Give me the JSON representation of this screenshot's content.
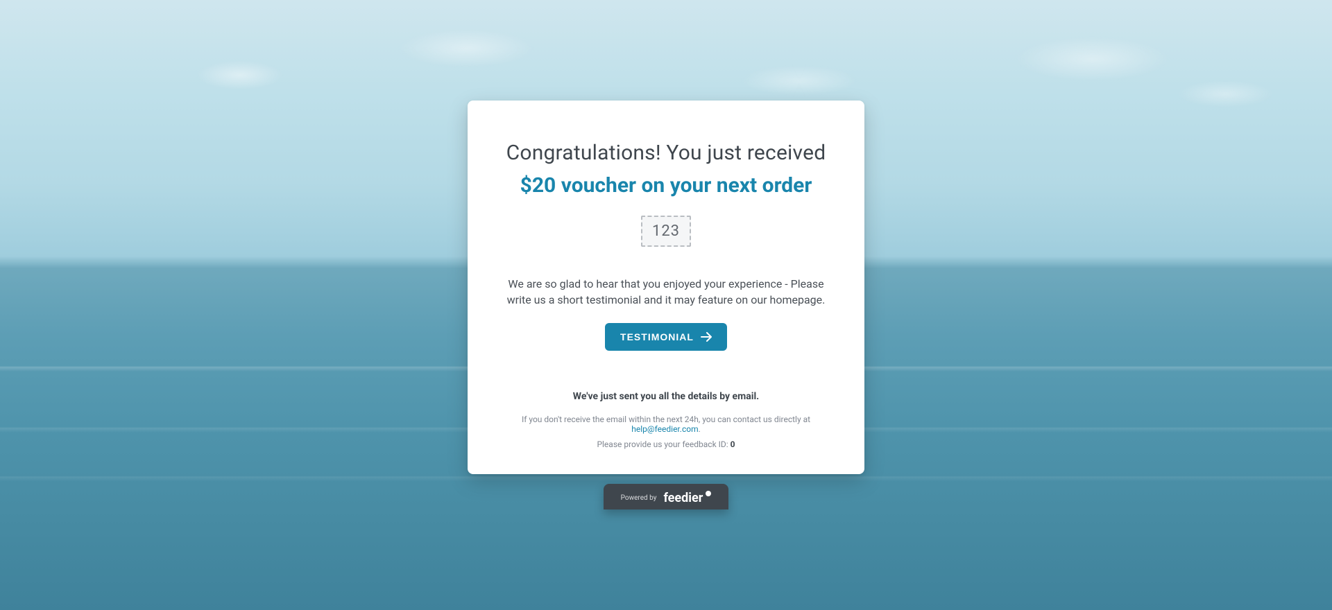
{
  "colors": {
    "accent": "#1985ac"
  },
  "card": {
    "heading": "Congratulations! You just received",
    "reward": "$20 voucher on your next order",
    "code": "123",
    "blurb": "We are so glad to hear that you enjoyed your experience - Please write us a short testimonial and it may feature on our homepage.",
    "cta_label": "TESTIMONIAL",
    "email_note": "We've just sent you all the details by email.",
    "help_prefix": "If you don't receive the email within the next 24h, you can contact us directly at ",
    "help_email": "help@feedier.com",
    "help_suffix": ".",
    "feedback_id_prefix": "Please provide us your feedback ID: ",
    "feedback_id": "0"
  },
  "footer": {
    "powered_by_label": "Powered by",
    "brand": "feedier"
  }
}
